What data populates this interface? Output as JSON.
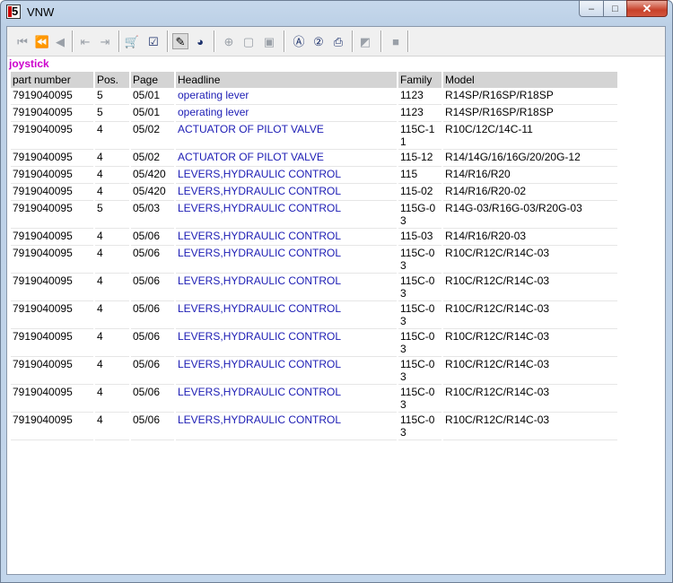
{
  "window": {
    "title": "VNW",
    "app_icon": "vnw-app-icon",
    "controls": {
      "minimize": "–",
      "maximize": "□",
      "close": "✕"
    }
  },
  "toolbar": {
    "buttons": [
      {
        "name": "first-record",
        "icon": "⏮",
        "state": "disabled"
      },
      {
        "name": "previous-page",
        "icon": "⏪",
        "state": "disabled"
      },
      {
        "name": "previous-record",
        "icon": "◀",
        "state": "disabled"
      },
      {
        "name": "export-left",
        "icon": "⇤",
        "state": "disabled"
      },
      {
        "name": "export-right",
        "icon": "⇥",
        "state": "disabled"
      },
      {
        "name": "cart",
        "icon": "🛒",
        "state": "enabled"
      },
      {
        "name": "checklist",
        "icon": "☑",
        "state": "enabled"
      },
      {
        "name": "marker",
        "icon": "✎",
        "state": "pressed"
      },
      {
        "name": "globe",
        "icon": "◕",
        "state": "enabled"
      },
      {
        "name": "zoom-in",
        "icon": "⊕",
        "state": "disabled"
      },
      {
        "name": "page-view",
        "icon": "▢",
        "state": "disabled"
      },
      {
        "name": "page-fit",
        "icon": "▣",
        "state": "disabled"
      },
      {
        "name": "search-a",
        "icon": "Ⓐ",
        "state": "enabled"
      },
      {
        "name": "search-2",
        "icon": "②",
        "state": "enabled"
      },
      {
        "name": "print",
        "icon": "⎙",
        "state": "enabled"
      },
      {
        "name": "eraser",
        "icon": "◩",
        "state": "disabled"
      },
      {
        "name": "stop",
        "icon": "■",
        "state": "disabled"
      }
    ]
  },
  "search_term": "joystick",
  "table": {
    "headers": [
      "part number",
      "Pos.",
      "Page",
      "Headline",
      "Family",
      "Model"
    ],
    "rows": [
      {
        "part": "7919040095",
        "pos": "5",
        "page": "05/01",
        "headline": "operating lever",
        "family": "1123",
        "model": "R14SP/R16SP/R18SP"
      },
      {
        "part": "7919040095",
        "pos": "5",
        "page": "05/01",
        "headline": "operating lever",
        "family": "1123",
        "model": "R14SP/R16SP/R18SP"
      },
      {
        "part": "7919040095",
        "pos": "4",
        "page": "05/02",
        "headline": "ACTUATOR OF PILOT VALVE",
        "family": "115C-11",
        "model": "R10C/12C/14C-11"
      },
      {
        "part": "7919040095",
        "pos": "4",
        "page": "05/02",
        "headline": "ACTUATOR OF PILOT VALVE",
        "family": "115-12",
        "model": "R14/14G/16/16G/20/20G-12"
      },
      {
        "part": "7919040095",
        "pos": "4",
        "page": "05/420",
        "headline": "LEVERS,HYDRAULIC CONTROL",
        "family": "115",
        "model": "R14/R16/R20"
      },
      {
        "part": "7919040095",
        "pos": "4",
        "page": "05/420",
        "headline": "LEVERS,HYDRAULIC CONTROL",
        "family": "115-02",
        "model": "R14/R16/R20-02"
      },
      {
        "part": "7919040095",
        "pos": "5",
        "page": "05/03",
        "headline": "LEVERS,HYDRAULIC CONTROL",
        "family": "115G-03",
        "model": "R14G-03/R16G-03/R20G-03"
      },
      {
        "part": "7919040095",
        "pos": "4",
        "page": "05/06",
        "headline": "LEVERS,HYDRAULIC CONTROL",
        "family": "115-03",
        "model": "R14/R16/R20-03"
      },
      {
        "part": "7919040095",
        "pos": "4",
        "page": "05/06",
        "headline": "LEVERS,HYDRAULIC CONTROL",
        "family": "115C-03",
        "model": "R10C/R12C/R14C-03"
      },
      {
        "part": "7919040095",
        "pos": "4",
        "page": "05/06",
        "headline": "LEVERS,HYDRAULIC CONTROL",
        "family": "115C-03",
        "model": "R10C/R12C/R14C-03"
      },
      {
        "part": "7919040095",
        "pos": "4",
        "page": "05/06",
        "headline": "LEVERS,HYDRAULIC CONTROL",
        "family": "115C-03",
        "model": "R10C/R12C/R14C-03"
      },
      {
        "part": "7919040095",
        "pos": "4",
        "page": "05/06",
        "headline": "LEVERS,HYDRAULIC CONTROL",
        "family": "115C-03",
        "model": "R10C/R12C/R14C-03"
      },
      {
        "part": "7919040095",
        "pos": "4",
        "page": "05/06",
        "headline": "LEVERS,HYDRAULIC CONTROL",
        "family": "115C-03",
        "model": "R10C/R12C/R14C-03"
      },
      {
        "part": "7919040095",
        "pos": "4",
        "page": "05/06",
        "headline": "LEVERS,HYDRAULIC CONTROL",
        "family": "115C-03",
        "model": "R10C/R12C/R14C-03"
      },
      {
        "part": "7919040095",
        "pos": "4",
        "page": "05/06",
        "headline": "LEVERS,HYDRAULIC CONTROL",
        "family": "115C-03",
        "model": "R10C/R12C/R14C-03"
      }
    ]
  },
  "colors": {
    "search_term": "#cc00cc",
    "headline_link": "#1c1cb4",
    "header_bg": "#d4d4d4"
  }
}
